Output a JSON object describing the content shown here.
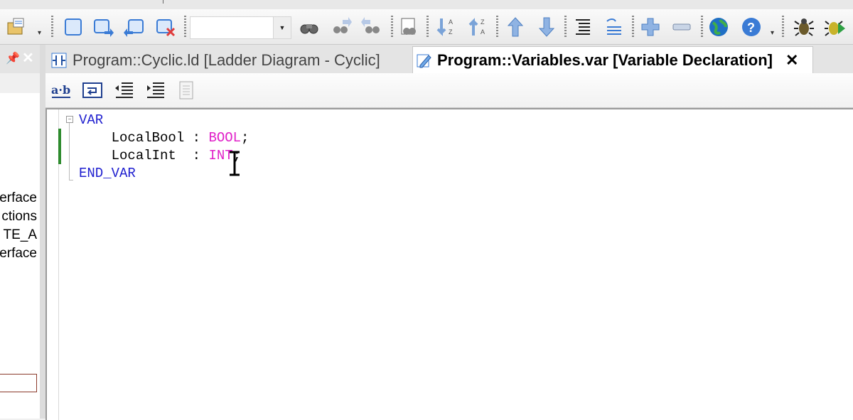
{
  "toolbar": {
    "combo_value": "",
    "icons": [
      "open-project-icon",
      "new-window-icon",
      "forward-window-icon",
      "back-window-icon",
      "close-window-icon",
      "binoculars-icon",
      "find-next-icon",
      "find-prev-icon",
      "print-preview-icon",
      "sort-ascending-icon",
      "sort-descending-icon",
      "move-up-icon",
      "move-down-icon",
      "indent-list-icon",
      "undo-list-icon",
      "zoom-in-icon",
      "zoom-out-icon",
      "globe-icon",
      "help-icon",
      "debug-bug-icon",
      "run-bug-icon"
    ]
  },
  "left_panel": {
    "items": [
      "erface",
      "ctions",
      "TE_A",
      "erface"
    ]
  },
  "tabs": [
    {
      "label": "Program::Cyclic.ld [Ladder Diagram - Cyclic]",
      "active": false
    },
    {
      "label": "Program::Variables.var [Variable Declaration]",
      "active": true
    }
  ],
  "editor_toolbar": {
    "icons": [
      "text-format-icon",
      "wrap-icon",
      "outdent-icon",
      "indent-icon",
      "page-icon"
    ]
  },
  "code": {
    "line1_kw": "VAR",
    "line2_name": "    LocalBool : ",
    "line2_type": "BOOL",
    "line2_end": ";",
    "line3_name": "    LocalInt  : ",
    "line3_type": "INT",
    "line3_end": ";",
    "line4_kw": "END_VAR"
  },
  "colors": {
    "keyword": "#1f1fcf",
    "type": "#e020c8",
    "change_marker": "#2e8b2e"
  }
}
